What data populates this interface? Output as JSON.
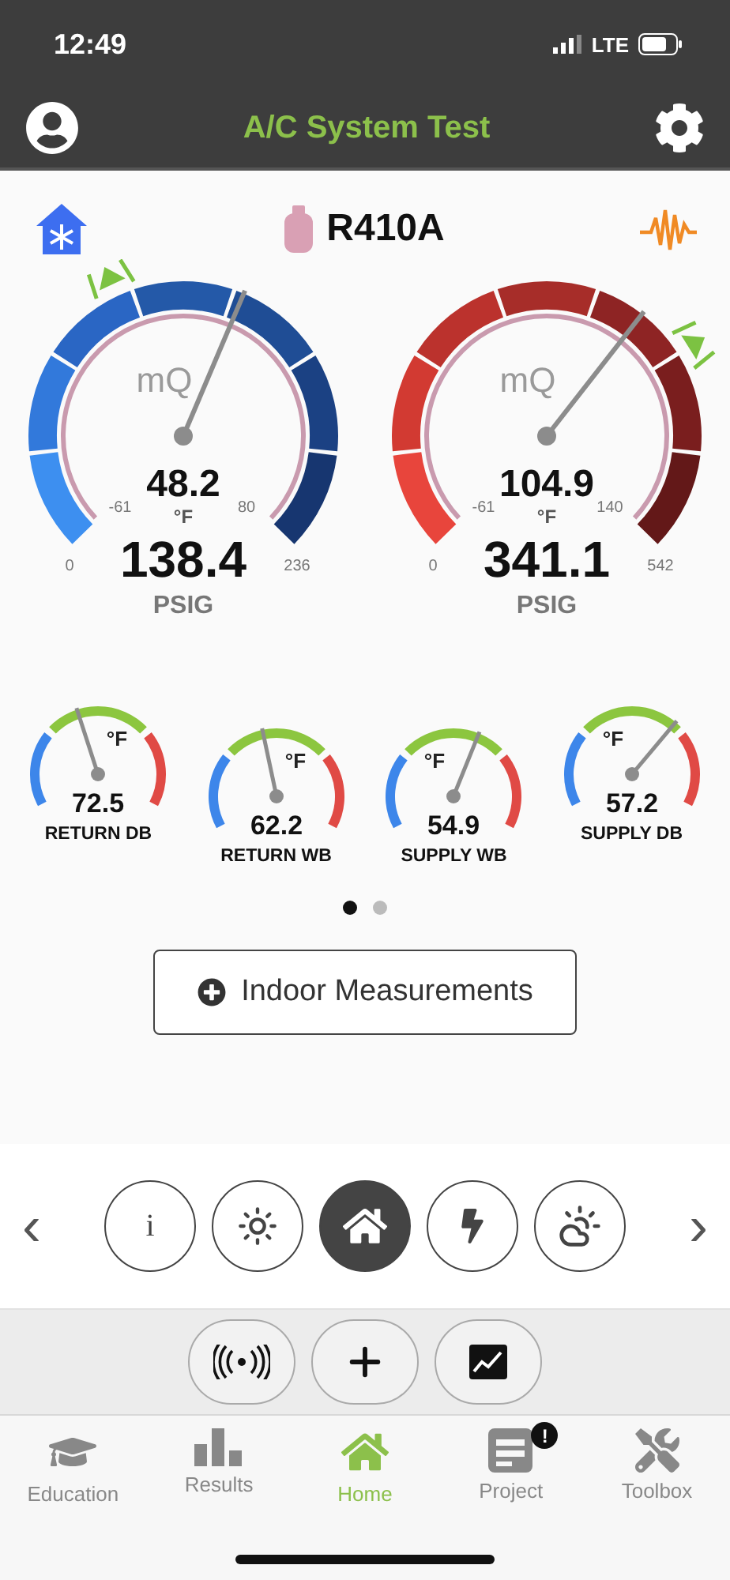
{
  "status_bar": {
    "time": "12:49",
    "network": "LTE"
  },
  "nav_bar": {
    "title": "A/C System Test"
  },
  "refrigerant": {
    "name": "R410A"
  },
  "pressure_gauges": [
    {
      "kind": "suction",
      "logo": "mQ",
      "temperature": "48.2",
      "temp_unit": "°F",
      "temp_min": "-61",
      "temp_max": "80",
      "pressure": "138.4",
      "pressure_unit": "PSIG",
      "pressure_min": "0",
      "pressure_max": "236"
    },
    {
      "kind": "discharge",
      "logo": "mQ",
      "temperature": "104.9",
      "temp_unit": "°F",
      "temp_min": "-61",
      "temp_max": "140",
      "pressure": "341.1",
      "pressure_unit": "PSIG",
      "pressure_min": "0",
      "pressure_max": "542"
    }
  ],
  "temperature_gauges": [
    {
      "unit": "°F",
      "value": "72.5",
      "label": "RETURN DB"
    },
    {
      "unit": "°F",
      "value": "62.2",
      "label": "RETURN WB"
    },
    {
      "unit": "°F",
      "value": "54.9",
      "label": "SUPPLY WB"
    },
    {
      "unit": "°F",
      "value": "57.2",
      "label": "SUPPLY DB"
    }
  ],
  "pager": [
    {
      "selected": true
    },
    {
      "selected": false
    }
  ],
  "indoor_button": {
    "label": "Indoor Measurements"
  },
  "carousel": {
    "prev": "‹",
    "next": "›",
    "items": [
      {
        "kind": "info",
        "text": "i",
        "selected": false
      },
      {
        "kind": "sun",
        "selected": false
      },
      {
        "kind": "home",
        "selected": true
      },
      {
        "kind": "bolt",
        "selected": false
      },
      {
        "kind": "weather",
        "selected": false
      }
    ]
  },
  "actions": [
    {
      "kind": "wireless"
    },
    {
      "kind": "add"
    },
    {
      "kind": "chart"
    }
  ],
  "tab_bar": [
    {
      "kind": "education",
      "label": "Education",
      "selected": false
    },
    {
      "kind": "results",
      "label": "Results",
      "selected": false
    },
    {
      "kind": "home",
      "label": "Home",
      "selected": true
    },
    {
      "kind": "project",
      "label": "Project",
      "selected": false,
      "badge": "!"
    },
    {
      "kind": "toolbox",
      "label": "Toolbox",
      "selected": false
    }
  ]
}
